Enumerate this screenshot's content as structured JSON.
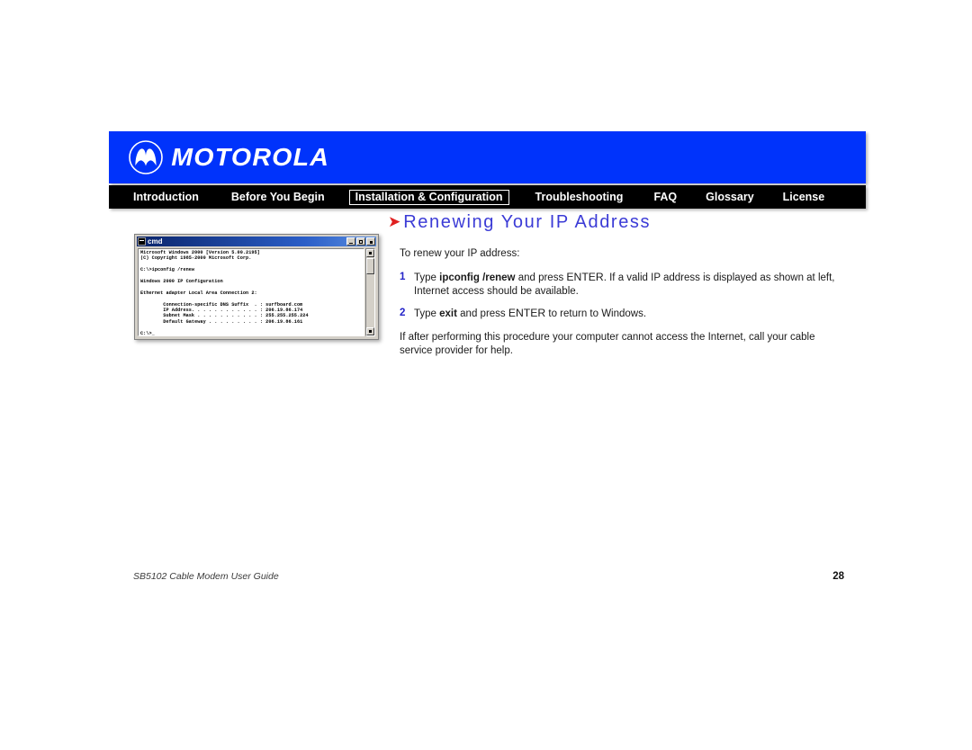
{
  "brand": {
    "wordmark": "MOTOROLA",
    "logo_icon": "motorola-batwing-icon",
    "banner_color": "#0033fb"
  },
  "nav": {
    "items": [
      {
        "label": "Introduction",
        "active": false
      },
      {
        "label": "Before You Begin",
        "active": false
      },
      {
        "label": "Installation & Configuration",
        "active": true
      },
      {
        "label": "Troubleshooting",
        "active": false
      },
      {
        "label": "FAQ",
        "active": false
      },
      {
        "label": "Glossary",
        "active": false
      },
      {
        "label": "License",
        "active": false
      }
    ]
  },
  "main": {
    "heading": "Renewing Your IP Address",
    "heading_marker": "➤",
    "heading_color": "#3b3bd6",
    "marker_color": "#e02020",
    "intro": "To renew your IP address:",
    "steps": [
      {
        "number": "1",
        "parts": [
          {
            "text": "Type ",
            "style": "normal"
          },
          {
            "text": "ipconfig",
            "style": "bold"
          },
          {
            "text": " ",
            "style": "normal"
          },
          {
            "text": "/renew",
            "style": "bold"
          },
          {
            "text": " and press ",
            "style": "normal"
          },
          {
            "text": "ENTER",
            "style": "smallcaps"
          },
          {
            "text": ". If a valid IP address is displayed as shown at left, Internet access should be available.",
            "style": "normal"
          }
        ]
      },
      {
        "number": "2",
        "parts": [
          {
            "text": "Type ",
            "style": "normal"
          },
          {
            "text": "exit",
            "style": "bold"
          },
          {
            "text": " and press ",
            "style": "normal"
          },
          {
            "text": "ENTER",
            "style": "smallcaps"
          },
          {
            "text": " to return to Windows.",
            "style": "normal"
          }
        ]
      }
    ],
    "closing": "If after performing this procedure your computer cannot access the Internet, call your cable service provider for help."
  },
  "cmd_window": {
    "title": "cmd",
    "buttons": {
      "minimize": "minimize-button",
      "maximize": "maximize-button",
      "close": "close-button"
    },
    "console_text": "Microsoft Windows 2000 [Version 5.00.2195]\n(C) Copyright 1985-2000 Microsoft Corp.\n\nC:\\>ipconfig /renew\n\nWindows 2000 IP Configuration\n\nEthernet adapter Local Area Connection 2:\n\n        Connection-specific DNS Suffix  . : surfboard.com\n        IP Address. . . . . . . . . . . . : 206.19.86.174\n        Subnet Mask . . . . . . . . . . . : 255.255.255.224\n        Default Gateway . . . . . . . . . : 206.19.86.161\n\nC:\\>_",
    "console_lines": [
      "Microsoft Windows 2000 [Version 5.00.2195]",
      "(C) Copyright 1985-2000 Microsoft Corp.",
      "",
      "C:\\>ipconfig /renew",
      "",
      "Windows 2000 IP Configuration",
      "",
      "Ethernet adapter Local Area Connection 2:",
      "",
      "        Connection-specific DNS Suffix  . : surfboard.com",
      "        IP Address. . . . . . . . . . . . : 206.19.86.174",
      "        Subnet Mask . . . . . . . . . . . : 255.255.255.224",
      "        Default Gateway . . . . . . . . . : 206.19.86.161",
      "",
      "C:\\>_"
    ],
    "values": {
      "dns_suffix": "surfboard.com",
      "ip_address": "206.19.86.174",
      "subnet_mask": "255.255.255.224",
      "default_gateway": "206.19.86.161",
      "os_version": "Microsoft Windows 2000 [Version 5.00.2195]",
      "copyright": "(C) Copyright 1985-2000 Microsoft Corp.",
      "command": "ipconfig /renew",
      "adapter": "Ethernet adapter Local Area Connection 2:"
    }
  },
  "footer": {
    "document_title": "SB5102 Cable Modem User Guide",
    "page_number": "28"
  }
}
